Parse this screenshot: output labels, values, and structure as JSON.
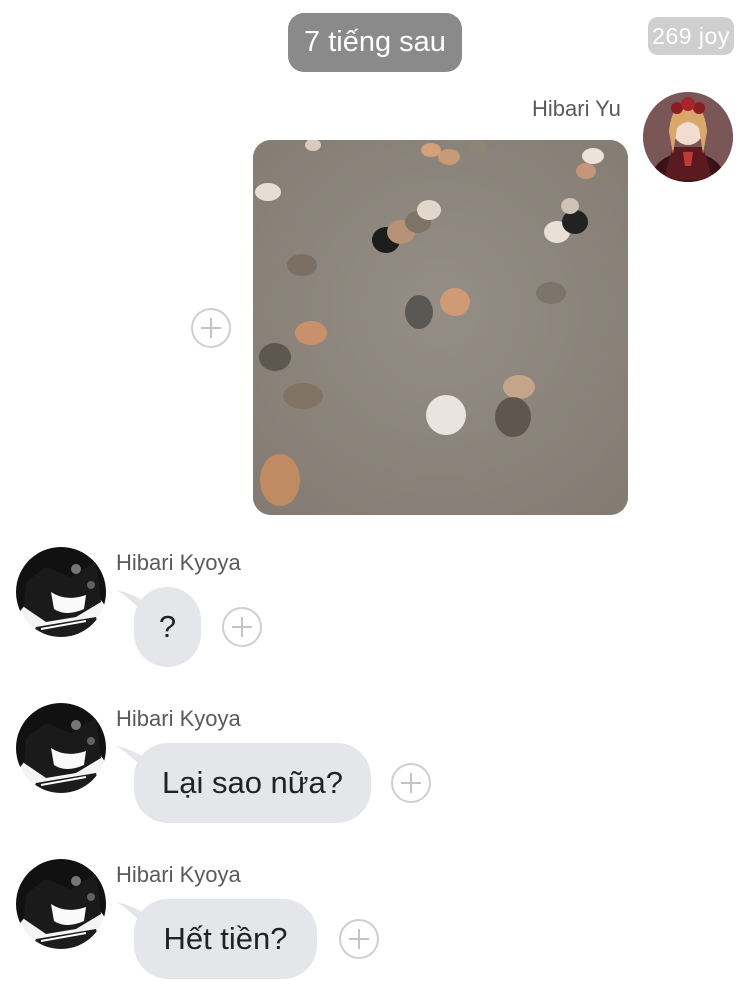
{
  "header": {
    "time_separator": "7 tiếng sau",
    "watermark": "269 joy"
  },
  "messages": [
    {
      "sender": "Hibari Yu",
      "side": "right",
      "type": "image",
      "image_description": "cats-on-carpet-photo"
    },
    {
      "sender": "Hibari Kyoya",
      "side": "left",
      "type": "text",
      "text": "?"
    },
    {
      "sender": "Hibari Kyoya",
      "side": "left",
      "type": "text",
      "text": "Lại sao nữa?"
    },
    {
      "sender": "Hibari Kyoya",
      "side": "left",
      "type": "text",
      "text": "Hết tiền?"
    }
  ],
  "colors": {
    "bubble_bg": "#e4e6ea",
    "time_pill_bg": "#8a8a8a",
    "name_color": "#5a5a5a"
  }
}
